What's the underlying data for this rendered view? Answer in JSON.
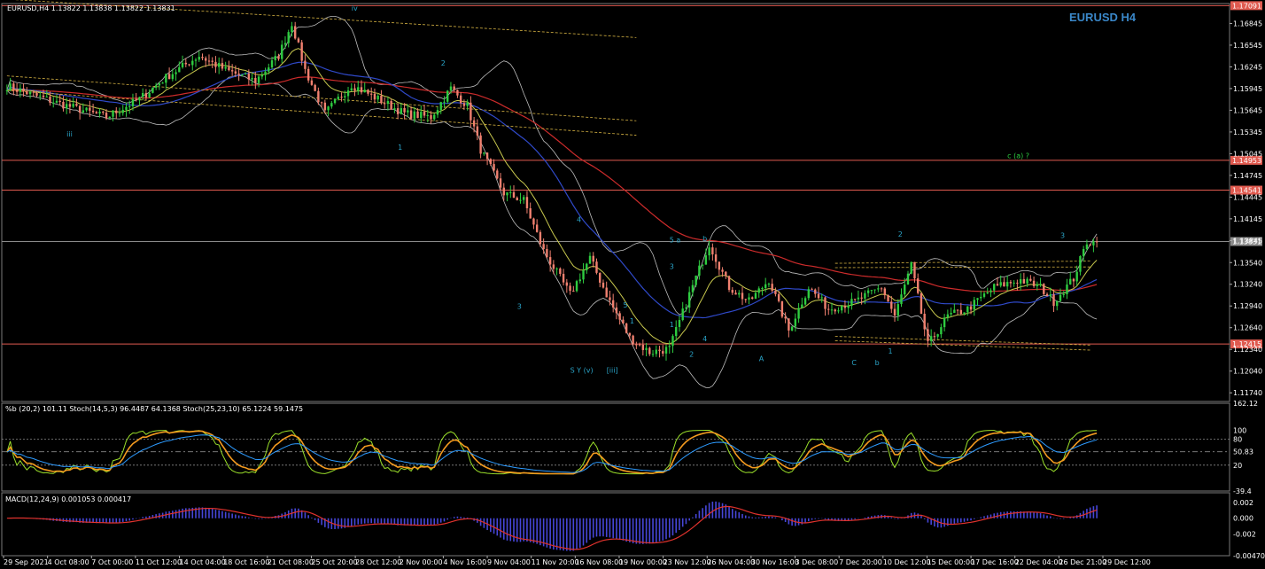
{
  "chart_data": [
    {
      "type": "candlestick",
      "header": "EURUSD,H4  1.13822 1.13838 1.13822 1.13831",
      "title": "EURUSD H4",
      "ylim": [
        1.1162,
        1.1712
      ],
      "y_ticks": [
        "1.16845",
        "1.16545",
        "1.16245",
        "1.15945",
        "1.15645",
        "1.15345",
        "1.15045",
        "1.14745",
        "1.14445",
        "1.14145",
        "1.13845",
        "1.13540",
        "1.13240",
        "1.12940",
        "1.12640",
        "1.12340",
        "1.12040",
        "1.11740"
      ],
      "x_ticks": [
        "29 Sep 2021",
        "4 Oct 08:00",
        "7 Oct 00:00",
        "11 Oct 12:00",
        "14 Oct 04:00",
        "18 Oct 16:00",
        "21 Oct 08:00",
        "25 Oct 20:00",
        "28 Oct 12:00",
        "2 Nov 00:00",
        "4 Nov 16:00",
        "9 Nov 04:00",
        "11 Nov 20:00",
        "16 Nov 08:00",
        "19 Nov 00:00",
        "23 Nov 12:00",
        "26 Nov 04:00",
        "30 Nov 16:00",
        "3 Dec 08:00",
        "7 Dec 20:00",
        "10 Dec 12:00",
        "15 Dec 00:00",
        "17 Dec 16:00",
        "22 Dec 04:00",
        "26 Dec 21:00",
        "29 Dec 12:00"
      ],
      "horizontal_levels": [
        {
          "price": 1.17091,
          "label": "1.17091",
          "color": "#e05a4f"
        },
        {
          "price": 1.14953,
          "label": "1.14953",
          "color": "#e05a4f"
        },
        {
          "price": 1.14541,
          "label": "1.14541",
          "color": "#e05a4f"
        },
        {
          "price": 1.13831,
          "label": "1.13831",
          "color": "#8a8a8a"
        },
        {
          "price": 1.12415,
          "label": "1.12415",
          "color": "#e05a4f"
        }
      ],
      "close_anchors": [
        [
          0,
          1.1598
        ],
        [
          15,
          1.1575
        ],
        [
          30,
          1.1555
        ],
        [
          40,
          1.158
        ],
        [
          48,
          1.161
        ],
        [
          58,
          1.164
        ],
        [
          66,
          1.162
        ],
        [
          75,
          1.1605
        ],
        [
          82,
          1.164
        ],
        [
          86,
          1.1685
        ],
        [
          90,
          1.162
        ],
        [
          96,
          1.156
        ],
        [
          104,
          1.16
        ],
        [
          112,
          1.158
        ],
        [
          120,
          1.156
        ],
        [
          128,
          1.1555
        ],
        [
          134,
          1.1595
        ],
        [
          139,
          1.157
        ],
        [
          143,
          1.151
        ],
        [
          150,
          1.145
        ],
        [
          156,
          1.144
        ],
        [
          162,
          1.137
        ],
        [
          170,
          1.131
        ],
        [
          176,
          1.136
        ],
        [
          182,
          1.13
        ],
        [
          188,
          1.125
        ],
        [
          194,
          1.123
        ],
        [
          200,
          1.1235
        ],
        [
          206,
          1.131
        ],
        [
          212,
          1.138
        ],
        [
          218,
          1.132
        ],
        [
          224,
          1.13
        ],
        [
          230,
          1.133
        ],
        [
          236,
          1.126
        ],
        [
          242,
          1.132
        ],
        [
          248,
          1.129
        ],
        [
          256,
          1.13
        ],
        [
          264,
          1.132
        ],
        [
          268,
          1.128
        ],
        [
          273,
          1.135
        ],
        [
          278,
          1.124
        ],
        [
          284,
          1.128
        ],
        [
          290,
          1.129
        ],
        [
          298,
          1.132
        ],
        [
          306,
          1.133
        ],
        [
          312,
          1.132
        ],
        [
          316,
          1.13
        ],
        [
          322,
          1.1332
        ],
        [
          326,
          1.1383
        ]
      ],
      "annotations": [
        "iii",
        "iv",
        "1",
        "2",
        "3",
        "4",
        "5",
        "5 a",
        "b",
        "1",
        "2",
        "3",
        "4",
        "A",
        "C",
        "b",
        "1",
        "2",
        "3",
        "c (a) ?",
        "S Y (v)",
        "[iii]",
        "1"
      ],
      "annotation_color": "#2aa4c8",
      "ma_colors": {
        "ema_slow": "#cc2b2b",
        "sma_mid": "#2f49c8",
        "fast": "#c8c84e",
        "bollinger": "#bdbdbd",
        "channel": "#d6b343"
      }
    },
    {
      "type": "line",
      "header": "%b (20,2) 101.11  Stoch(14,5,3) 96.4487 64.1368  Stoch(25,23,10) 65.1224 59.1475",
      "ylim": [
        -39.4,
        162.12
      ],
      "y_ticks": [
        "162.12",
        "80",
        "100",
        "50.83",
        "20",
        "-39.4"
      ],
      "levels": [
        80,
        50.83,
        20
      ],
      "series": [
        {
          "color": "#9be02a"
        },
        {
          "color": "#f39a1f"
        },
        {
          "color": "#2d9bff"
        }
      ]
    },
    {
      "type": "histogram",
      "header": "MACD(12,24,9) 0.001053 0.000417",
      "ylim": [
        -0.004704,
        0.0032
      ],
      "y_ticks": [
        "0.002",
        "0.000",
        "-0.002",
        "-0.004704"
      ],
      "series": [
        {
          "color": "#4646d8"
        },
        {
          "color": "#e0322d"
        }
      ]
    }
  ]
}
